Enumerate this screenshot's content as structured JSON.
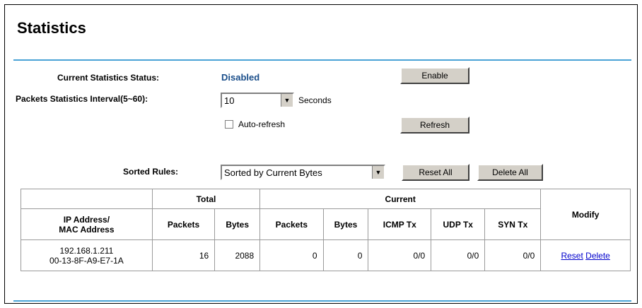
{
  "page": {
    "title": "Statistics"
  },
  "status": {
    "label": "Current Statistics Status:",
    "value": "Disabled",
    "enable_button": "Enable"
  },
  "interval": {
    "label": "Packets Statistics Interval(5~60):",
    "value": "10",
    "unit": "Seconds"
  },
  "auto_refresh": {
    "label": "Auto-refresh",
    "checked": false,
    "refresh_button": "Refresh"
  },
  "sorted": {
    "label": "Sorted Rules:",
    "value": "Sorted by Current Bytes",
    "reset_all": "Reset All",
    "delete_all": "Delete All"
  },
  "table": {
    "group_total": "Total",
    "group_current": "Current",
    "col_ip": "IP Address/",
    "col_mac": "MAC Address",
    "col_packets": "Packets",
    "col_bytes": "Bytes",
    "col_cur_packets": "Packets",
    "col_cur_bytes": "Bytes",
    "col_icmp": "ICMP Tx",
    "col_udp": "UDP Tx",
    "col_syn": "SYN Tx",
    "col_modify": "Modify",
    "rows": [
      {
        "ip": "192.168.1.211",
        "mac": "00-13-8F-A9-E7-1A",
        "total_packets": "16",
        "total_bytes": "2088",
        "cur_packets": "0",
        "cur_bytes": "0",
        "icmp": "0/0",
        "udp": "0/0",
        "syn": "0/0",
        "reset": "Reset",
        "delete": "Delete"
      }
    ]
  }
}
